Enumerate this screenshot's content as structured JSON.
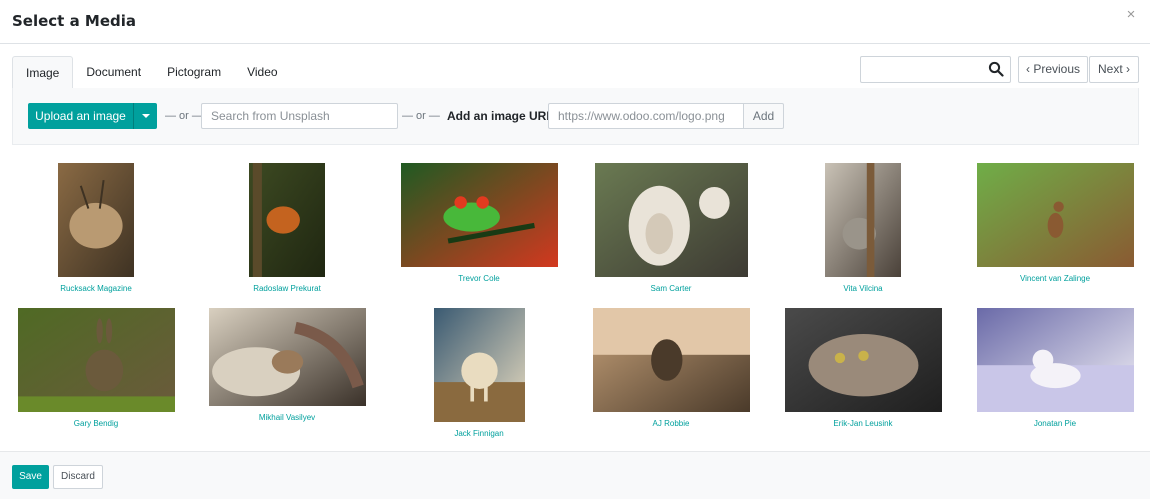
{
  "dialog": {
    "title": "Select a Media",
    "close_glyph": "×"
  },
  "tabs": [
    {
      "label": "Image"
    },
    {
      "label": "Document"
    },
    {
      "label": "Pictogram"
    },
    {
      "label": "Video"
    }
  ],
  "search": {
    "value": "",
    "placeholder": ""
  },
  "pager": {
    "previous": "‹ Previous",
    "next": "Next ›"
  },
  "toolbar": {
    "upload_label": "Upload an image",
    "or_text": "— or —",
    "unsplash_placeholder": "Search from Unsplash",
    "url_label": "Add an image URL",
    "url_placeholder": "https://www.odoo.com/logo.png",
    "add_label": "Add"
  },
  "images": [
    {
      "author": "Rucksack Magazine",
      "subject": "deer",
      "palette": [
        "#8a6a44",
        "#b99a72",
        "#3e3223"
      ]
    },
    {
      "author": "Radoslaw Prekurat",
      "subject": "squirrel",
      "palette": [
        "#3d4a22",
        "#c4631f",
        "#1f2611"
      ]
    },
    {
      "author": "Trevor Cole",
      "subject": "tree-frog",
      "palette": [
        "#1f5a22",
        "#48b83a",
        "#d3381f"
      ]
    },
    {
      "author": "Sam Carter",
      "subject": "sheep",
      "palette": [
        "#6a7a52",
        "#e9e3d8",
        "#3d3a33"
      ]
    },
    {
      "author": "Vita Vilcina",
      "subject": "koala",
      "palette": [
        "#c9c2b6",
        "#7b5b3a",
        "#4a4139"
      ]
    },
    {
      "author": "Vincent van Zalinge",
      "subject": "fawn",
      "palette": [
        "#6fae48",
        "#c8e0a8",
        "#8a5a32"
      ]
    },
    {
      "author": "Gary Bendig",
      "subject": "rabbit",
      "palette": [
        "#4f6a24",
        "#c2a24a",
        "#6b5a3c"
      ]
    },
    {
      "author": "Mikhail Vasilyev",
      "subject": "cat",
      "palette": [
        "#d9d0c0",
        "#9a7a5a",
        "#3a3129"
      ]
    },
    {
      "author": "Jack Finnigan",
      "subject": "horse",
      "palette": [
        "#3a5a72",
        "#b99a62",
        "#e9dcc0"
      ]
    },
    {
      "author": "AJ Robbie",
      "subject": "elephant",
      "palette": [
        "#c7a27a",
        "#8a6a3f",
        "#4a3a2a"
      ]
    },
    {
      "author": "Erik-Jan Leusink",
      "subject": "kitten",
      "palette": [
        "#4a4a4a",
        "#9a8a7a",
        "#1f1f1f"
      ]
    },
    {
      "author": "Jonatan Pie",
      "subject": "arctic-fox",
      "palette": [
        "#6a6aa8",
        "#c9c6e8",
        "#f4f2f8"
      ]
    }
  ],
  "footer": {
    "save_label": "Save",
    "discard_label": "Discard"
  },
  "colors": {
    "accent": "#00a09d",
    "link": "#00a09d",
    "panel_bg": "#f8f9fa"
  }
}
